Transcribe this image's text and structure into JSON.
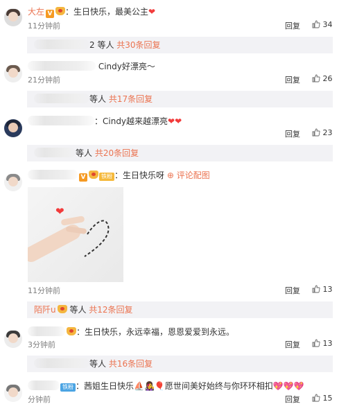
{
  "comments": [
    {
      "username": "大左",
      "text": "：生日快乐，最美公主",
      "time": "11分钟前",
      "reply": "回复",
      "likes": "34",
      "sub": {
        "prefix": "2 等人",
        "total": "共30条回复"
      }
    },
    {
      "text": "Cindy好漂亮～",
      "time": "21分钟前",
      "reply": "回复",
      "likes": "26",
      "sub": {
        "prefix": "等人",
        "total": "共17条回复"
      }
    },
    {
      "text": "：Cindy越来越漂亮",
      "reply": "回复",
      "likes": "23",
      "sub": {
        "prefix": "等人",
        "total": "共20条回复"
      }
    },
    {
      "fan_badge": "铁粉",
      "text": "：生日快乐呀",
      "pic_link": "评论配图",
      "time": "11分钟前",
      "reply": "回复",
      "likes": "13",
      "sub": {
        "username": "陌阡u",
        "prefix": "等人",
        "total": "共12条回复"
      }
    },
    {
      "text": "：生日快乐，永远幸福，恩恩爱爱到永远。",
      "time": "3分钟前",
      "reply": "回复",
      "likes": "13",
      "sub": {
        "prefix": "等人",
        "total": "共16条回复"
      }
    },
    {
      "fan_badge": "铁粉",
      "text": "：茜姐生日快乐",
      "text_tail": "愿世间美好始终与你环环相扣",
      "time": "分钟前",
      "reply": "回复",
      "likes": "15"
    }
  ],
  "icons": {
    "like": "thumb-up-icon",
    "vip": "v-badge-icon",
    "crown": "crown-icon",
    "heart": "heart-icon",
    "avatar": "avatar-icon"
  },
  "colors": {
    "username": "#eb7350",
    "subbar_bg": "#f2f2f5",
    "time": "#808080"
  }
}
